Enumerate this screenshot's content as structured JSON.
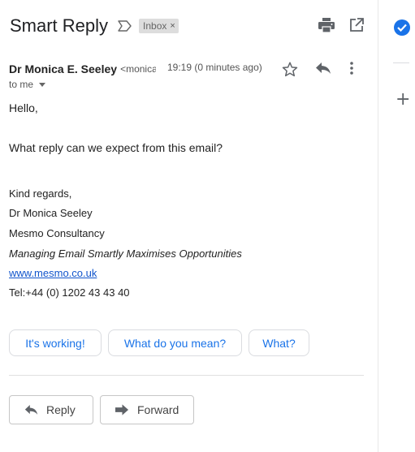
{
  "email": {
    "subject": "Smart Reply",
    "label_chip": "Inbox",
    "label_remove": "×",
    "sender_name": "Dr Monica E. Seeley",
    "sender_email_truncated": "<monica",
    "timestamp": "19:19 (0 minutes ago)",
    "recipient": "to me"
  },
  "body": {
    "greeting": "Hello,",
    "question": "What reply can we expect from this email?",
    "signature": {
      "closing": "Kind regards,",
      "name": "Dr Monica Seeley",
      "company": "Mesmo Consultancy",
      "tagline": "Managing Email Smartly Maximises Opportunities",
      "website": "www.mesmo.co.uk",
      "phone": "Tel:+44 (0) 1202 43 43 40"
    }
  },
  "smart_replies": [
    "It's working!",
    "What do you mean?",
    "What?"
  ],
  "actions": {
    "reply_label": "Reply",
    "forward_label": "Forward"
  },
  "icons": {
    "print": "print-icon",
    "popout": "open-in-new-window-icon",
    "star": "star-icon",
    "reply": "reply-icon",
    "more": "more-vert-icon",
    "important": "important-marker-icon",
    "tasks": "tasks-check-icon",
    "add": "add-icon"
  },
  "colors": {
    "accent": "#1a73e8",
    "link": "#1155cc",
    "chip_bg": "#dddddd"
  }
}
